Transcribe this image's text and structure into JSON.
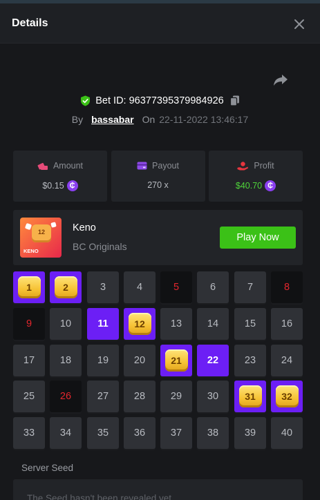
{
  "header": {
    "title": "Details"
  },
  "bet": {
    "id_text": "Bet ID: 96377395379984926",
    "by_label": "By",
    "username": "bassabar",
    "on_label": "On",
    "date": "22-11-2022 13:46:17"
  },
  "stats": [
    {
      "label": "Amount",
      "value": "$0.15",
      "coin": "₵"
    },
    {
      "label": "Payout",
      "value": "270 x"
    },
    {
      "label": "Profit",
      "value": "$40.70",
      "coin": "₵"
    }
  ],
  "colors": {
    "accent": "#6c1ff5",
    "win": "#3bc117",
    "miss": "#e3262d",
    "background": "#17181b"
  },
  "game": {
    "name": "Keno",
    "provider": "BC Originals",
    "play_label": "Play Now",
    "thumb_tile": "12",
    "thumb_name": "KENO"
  },
  "board": {
    "cells": [
      {
        "n": "1",
        "s": "hit"
      },
      {
        "n": "2",
        "s": "hit"
      },
      {
        "n": "3",
        "s": "normal"
      },
      {
        "n": "4",
        "s": "normal"
      },
      {
        "n": "5",
        "s": "miss"
      },
      {
        "n": "6",
        "s": "normal"
      },
      {
        "n": "7",
        "s": "normal"
      },
      {
        "n": "8",
        "s": "miss"
      },
      {
        "n": "9",
        "s": "miss"
      },
      {
        "n": "10",
        "s": "normal"
      },
      {
        "n": "11",
        "s": "pick"
      },
      {
        "n": "12",
        "s": "hit"
      },
      {
        "n": "13",
        "s": "normal"
      },
      {
        "n": "14",
        "s": "normal"
      },
      {
        "n": "15",
        "s": "normal"
      },
      {
        "n": "16",
        "s": "normal"
      },
      {
        "n": "17",
        "s": "normal"
      },
      {
        "n": "18",
        "s": "normal"
      },
      {
        "n": "19",
        "s": "normal"
      },
      {
        "n": "20",
        "s": "normal"
      },
      {
        "n": "21",
        "s": "hit"
      },
      {
        "n": "22",
        "s": "pick"
      },
      {
        "n": "23",
        "s": "normal"
      },
      {
        "n": "24",
        "s": "normal"
      },
      {
        "n": "25",
        "s": "normal"
      },
      {
        "n": "26",
        "s": "miss"
      },
      {
        "n": "27",
        "s": "normal"
      },
      {
        "n": "28",
        "s": "normal"
      },
      {
        "n": "29",
        "s": "normal"
      },
      {
        "n": "30",
        "s": "normal"
      },
      {
        "n": "31",
        "s": "hit"
      },
      {
        "n": "32",
        "s": "hit"
      },
      {
        "n": "33",
        "s": "normal"
      },
      {
        "n": "34",
        "s": "normal"
      },
      {
        "n": "35",
        "s": "normal"
      },
      {
        "n": "36",
        "s": "normal"
      },
      {
        "n": "37",
        "s": "normal"
      },
      {
        "n": "38",
        "s": "normal"
      },
      {
        "n": "39",
        "s": "normal"
      },
      {
        "n": "40",
        "s": "normal"
      }
    ]
  },
  "server_seed": {
    "label": "Server Seed",
    "value": "The Seed hasn't been revealed yet"
  }
}
